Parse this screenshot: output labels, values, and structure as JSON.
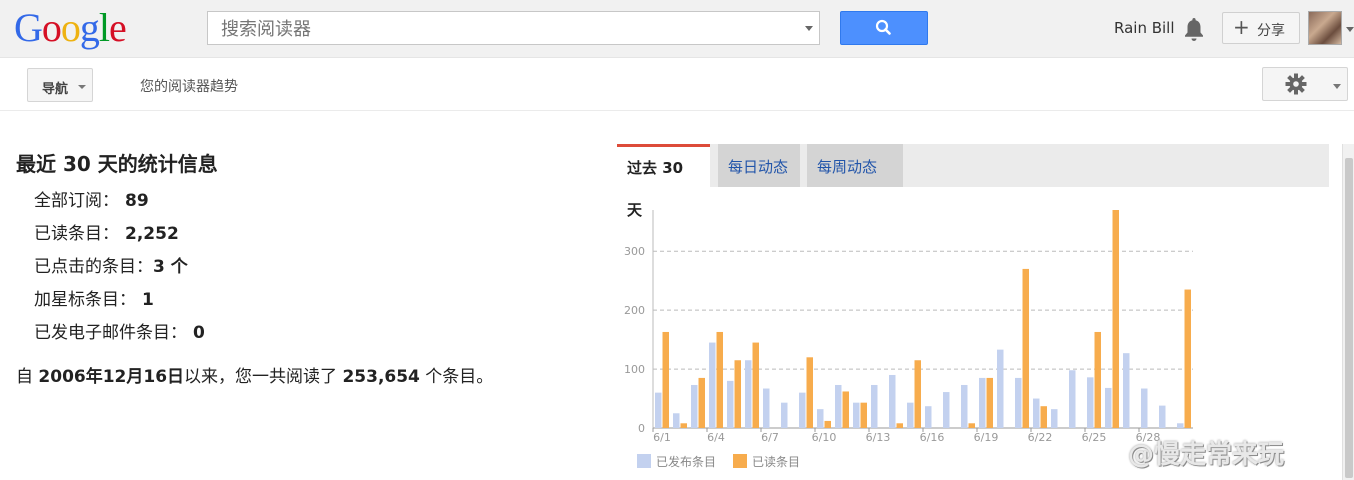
{
  "header": {
    "logo_letters": [
      {
        "ch": "G",
        "color": "#3369e8"
      },
      {
        "ch": "o",
        "color": "#d50f25"
      },
      {
        "ch": "o",
        "color": "#eeb211"
      },
      {
        "ch": "g",
        "color": "#3369e8"
      },
      {
        "ch": "l",
        "color": "#009925"
      },
      {
        "ch": "e",
        "color": "#d50f25"
      }
    ],
    "search_placeholder": "搜索阅读器",
    "search_icon": "search-icon",
    "user_name": "Rain Bill",
    "notification_icon": "bell-icon",
    "share_label": "分享",
    "share_icon": "plus-icon"
  },
  "subbar": {
    "nav_label": "导航",
    "page_title": "您的阅读器趋势",
    "settings_icon": "gear-icon"
  },
  "stats": {
    "title": "最近 30 天的统计信息",
    "rows": [
      {
        "label": "全部订阅：",
        "value": "89"
      },
      {
        "label": "已读条目：",
        "value": "2,252"
      },
      {
        "label": "已点击的条目：",
        "value": "3 个"
      },
      {
        "label": "加星标条目：",
        "value": "1"
      },
      {
        "label": "已发电子邮件条目：",
        "value": "0"
      }
    ],
    "since_prefix": "自 ",
    "since_date": "2006年12月16日",
    "since_middle": "以来，您一共阅读了 ",
    "since_count": "253,654",
    "since_suffix": " 个条目。"
  },
  "tabs": [
    {
      "label": "过去 30 天",
      "active": true
    },
    {
      "label": "每日动态",
      "active": false
    },
    {
      "label": "每周动态",
      "active": false
    }
  ],
  "chart_data": {
    "type": "bar",
    "categories": [
      "6/1",
      "6/2",
      "6/3",
      "6/4",
      "6/5",
      "6/6",
      "6/7",
      "6/8",
      "6/9",
      "6/10",
      "6/11",
      "6/12",
      "6/13",
      "6/14",
      "6/15",
      "6/16",
      "6/17",
      "6/18",
      "6/19",
      "6/20",
      "6/21",
      "6/22",
      "6/23",
      "6/24",
      "6/25",
      "6/26",
      "6/27",
      "6/28",
      "6/29",
      "6/30"
    ],
    "tick_labels": [
      "6/1",
      "6/4",
      "6/7",
      "6/10",
      "6/13",
      "6/16",
      "6/19",
      "6/22",
      "6/25",
      "6/28"
    ],
    "series": [
      {
        "name": "已发布条目",
        "color": "#c3d1ef",
        "values": [
          60,
          25,
          73,
          145,
          80,
          115,
          67,
          43,
          60,
          32,
          73,
          43,
          73,
          90,
          43,
          37,
          61,
          73,
          85,
          133,
          85,
          50,
          32,
          98,
          86,
          68,
          127,
          67,
          38,
          8
        ]
      },
      {
        "name": "已读条目",
        "color": "#f7ac4d",
        "values": [
          163,
          8,
          85,
          163,
          115,
          145,
          0,
          0,
          120,
          12,
          62,
          43,
          0,
          8,
          115,
          0,
          0,
          8,
          85,
          0,
          270,
          37,
          0,
          0,
          163,
          370,
          0,
          0,
          0,
          235
        ]
      }
    ],
    "ylim": [
      0,
      370
    ],
    "yticks": [
      0,
      100,
      200,
      300
    ],
    "grid": true,
    "legend": "bottom-left"
  },
  "watermark": "@慢走常来玩"
}
